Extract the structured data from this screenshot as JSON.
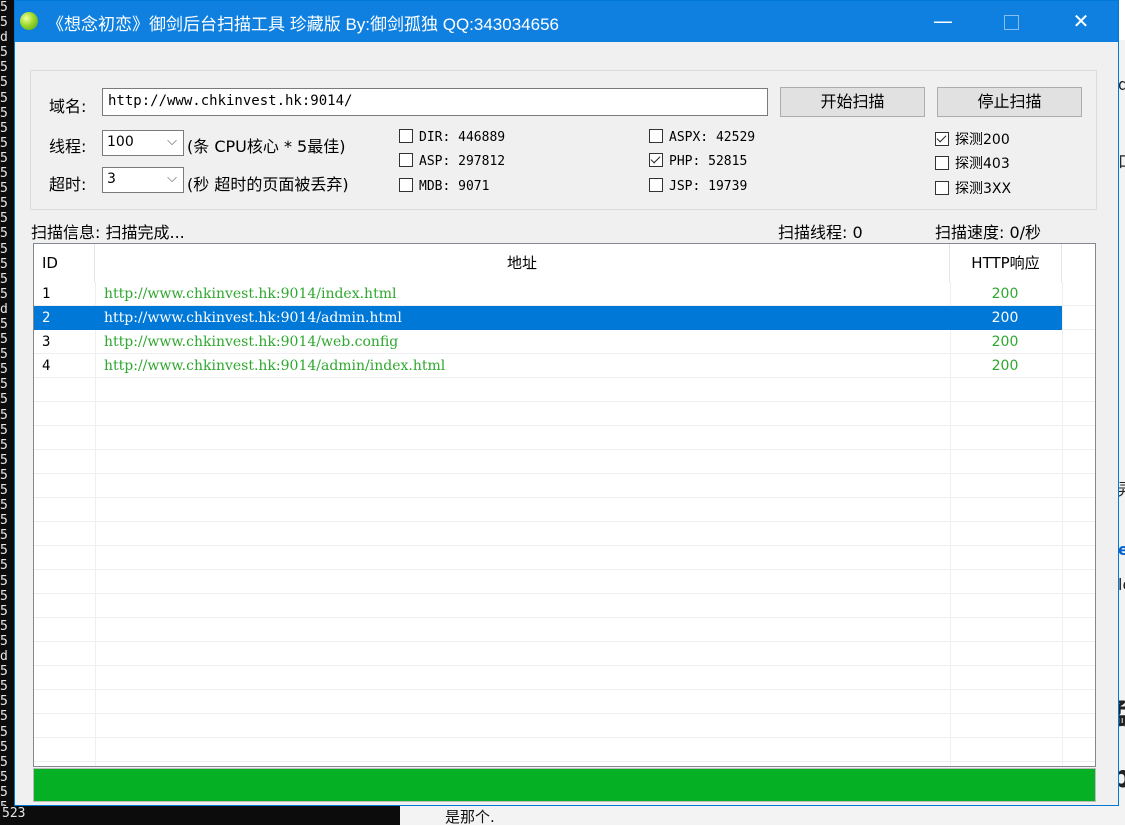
{
  "background": {
    "left_strip_lines": [
      "5",
      "5",
      "d",
      "5",
      "5",
      "5",
      "5",
      "5",
      "5",
      "5",
      "5",
      "5",
      "5",
      "5",
      "5",
      "5",
      "5",
      "5",
      "5",
      "5",
      "d",
      "5",
      "5",
      "5",
      "5",
      "5",
      "5",
      "5",
      "5",
      "5",
      "5",
      "5",
      "5",
      "5",
      "5",
      "5",
      "5",
      "5",
      "5",
      "5",
      "5",
      "5",
      "5",
      "d",
      "5",
      "5",
      "5",
      "5",
      "5",
      "5",
      "5",
      "5",
      "5",
      "5"
    ],
    "bottom_left_text": "523",
    "bottom_right_text": "是那个.",
    "right_edge_glyphs": [
      "d:",
      "口",
      "弄",
      "e",
      "lo",
      "勐",
      "b"
    ]
  },
  "window": {
    "title": "《想念初恋》御剑后台扫描工具 珍藏版 By:御剑孤独 QQ:343034656",
    "minimize_glyph": "—",
    "close_glyph": "✕"
  },
  "form": {
    "domain_label": "域名:",
    "domain_value": "http://www.chkinvest.hk:9014/",
    "start_button": "开始扫描",
    "stop_button": "停止扫描",
    "threads_label": "线程:",
    "threads_value": "100",
    "threads_hint": "(条 CPU核心 * 5最佳)",
    "timeout_label": "超时:",
    "timeout_value": "3",
    "timeout_hint": "(秒 超时的页面被丢弃)",
    "dicts": [
      {
        "label": "DIR: 446889",
        "checked": false
      },
      {
        "label": "ASP: 297812",
        "checked": false
      },
      {
        "label": "MDB: 9071",
        "checked": false
      },
      {
        "label": "ASPX: 42529",
        "checked": false
      },
      {
        "label": "PHP: 52815",
        "checked": true
      },
      {
        "label": "JSP: 19739",
        "checked": false
      }
    ],
    "probes": [
      {
        "label": "探测200",
        "checked": true
      },
      {
        "label": "探测403",
        "checked": false
      },
      {
        "label": "探测3XX",
        "checked": false
      }
    ]
  },
  "status": {
    "info": "扫描信息: 扫描完成...",
    "threads": "扫描线程: 0",
    "speed": "扫描速度: 0/秒"
  },
  "table": {
    "columns": [
      "ID",
      "地址",
      "HTTP响应"
    ],
    "rows": [
      {
        "id": "1",
        "url": "http://www.chkinvest.hk:9014/index.html",
        "code": "200",
        "selected": false
      },
      {
        "id": "2",
        "url": "http://www.chkinvest.hk:9014/admin.html",
        "code": "200",
        "selected": true
      },
      {
        "id": "3",
        "url": "http://www.chkinvest.hk:9014/web.config",
        "code": "200",
        "selected": false
      },
      {
        "id": "4",
        "url": "http://www.chkinvest.hk:9014/admin/index.html",
        "code": "200",
        "selected": false
      }
    ]
  },
  "progress": {
    "value": 1.0,
    "color": "#06b025"
  },
  "colors": {
    "titlebar": "#0f80e0",
    "selection": "#0078d7",
    "result_text": "#2fa82f"
  }
}
